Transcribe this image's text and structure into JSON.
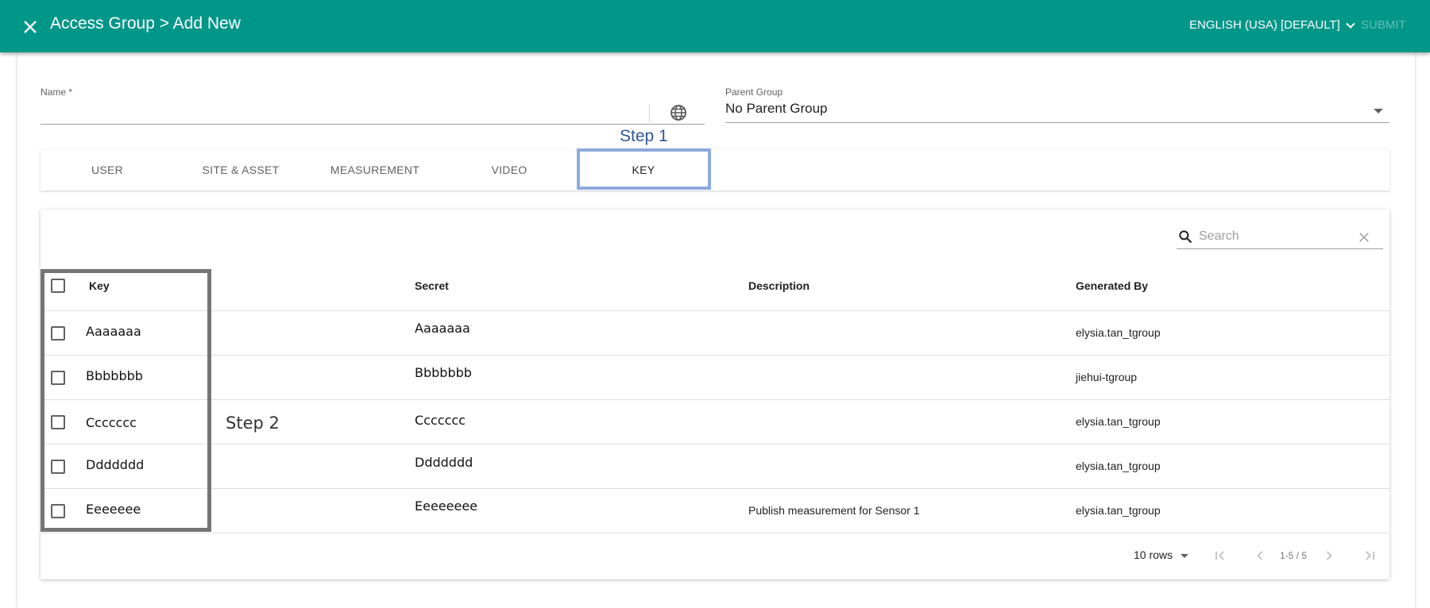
{
  "appbar": {
    "title": "Access Group > Add New",
    "language": "ENGLISH (USA) [DEFAULT]",
    "submit_label": "SUBMIT"
  },
  "form": {
    "name_label": "Name *",
    "name_value": "",
    "parent_label": "Parent Group",
    "parent_value": "No Parent Group"
  },
  "tabs": [
    {
      "label": "USER"
    },
    {
      "label": "SITE & ASSET"
    },
    {
      "label": "MEASUREMENT"
    },
    {
      "label": "VIDEO"
    },
    {
      "label": "KEY",
      "active": true
    }
  ],
  "annotations": {
    "step1": "Step 1",
    "step2": "Step 2",
    "step1_color": "#8ea9db",
    "step2_color": "#757575"
  },
  "search": {
    "placeholder": "Search"
  },
  "table": {
    "headers": {
      "key": "Key",
      "secret": "Secret",
      "description": "Description",
      "generated_by": "Generated By"
    },
    "rows": [
      {
        "key": "Aaaaaaa",
        "secret": "Aaaaaaa",
        "description": "",
        "generated_by": "elysia.tan_tgroup"
      },
      {
        "key": "Bbbbbbb",
        "secret": "Bbbbbbb",
        "description": "",
        "generated_by": "jiehui-tgroup"
      },
      {
        "key": "Ccccccc",
        "secret": "Ccccccc",
        "description": "",
        "generated_by": "elysia.tan_tgroup"
      },
      {
        "key": "Ddddddd",
        "secret": "Ddddddd",
        "description": "",
        "generated_by": "elysia.tan_tgroup"
      },
      {
        "key": "Eeeeeee",
        "secret": "Eeeeeeee",
        "description": "Publish measurement for Sensor 1",
        "generated_by": "elysia.tan_tgroup"
      }
    ]
  },
  "pagination": {
    "rows_per_page": "10 rows",
    "range": "1-5 / 5"
  },
  "colors": {
    "appbar": "#009688"
  }
}
